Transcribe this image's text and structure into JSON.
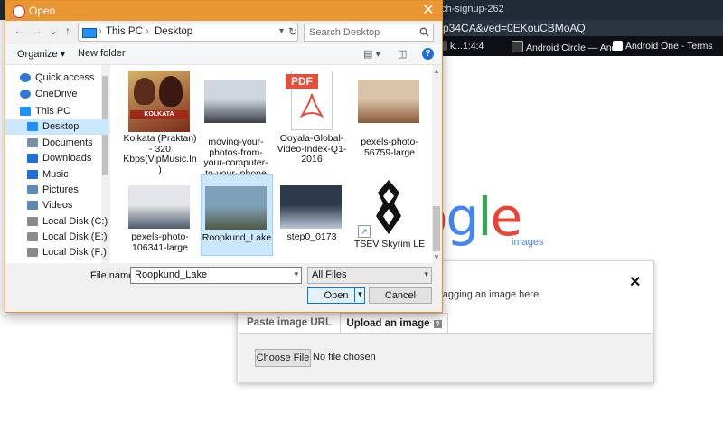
{
  "browser": {
    "tab_text": "ch-signup-262",
    "url_fragment": "p34CA&ved=0EKouCBMoAQ",
    "bookmarks": [
      {
        "label": "k...1:4:4",
        "icon": "bookmark-icon"
      },
      {
        "label": "Android Circle — And",
        "icon": "android-circle-icon"
      },
      {
        "label": "Android One - Terms",
        "icon": "android-one-icon"
      }
    ],
    "colors": {
      "topbar": "#1f2a36",
      "bookmarks_bg": "#0c0f14"
    }
  },
  "google": {
    "logo_letters": [
      "o",
      "g",
      "l",
      "e"
    ],
    "logo_colors": [
      "#ea4335",
      "#4285f4",
      "#34a853",
      "#ea4335"
    ],
    "images_label": "images"
  },
  "search_panel": {
    "hint": "dragging an image here.",
    "close": "✕",
    "tabs": [
      {
        "label": "Paste image URL",
        "active": false
      },
      {
        "label": "Upload an image",
        "active": true
      }
    ],
    "help": "?",
    "choose_file": "Choose File",
    "no_file": "No file chosen"
  },
  "dialog": {
    "title": "Open",
    "close": "✕",
    "nav": {
      "back": "←",
      "forward": "→",
      "recent": "⌄",
      "up": "↑"
    },
    "path": [
      "This PC",
      "Desktop"
    ],
    "path_sep": "›",
    "search_placeholder": "Search Desktop",
    "toolbar": {
      "organize": "Organize ▾",
      "new_folder": "New folder",
      "help": "?"
    },
    "sidebar": [
      {
        "label": "Quick access",
        "icon": "star-icon",
        "color": "#2b7bd6",
        "indent": 0,
        "selected": false
      },
      {
        "label": "OneDrive",
        "icon": "cloud-icon",
        "color": "#2b7bd6",
        "indent": 0,
        "selected": false
      },
      {
        "label": "This PC",
        "icon": "computer-icon",
        "color": "#1e90ff",
        "indent": 0,
        "selected": false
      },
      {
        "label": "Desktop",
        "icon": "desktop-icon",
        "color": "#1e90ff",
        "indent": 1,
        "selected": true
      },
      {
        "label": "Documents",
        "icon": "documents-icon",
        "color": "#7a8fa6",
        "indent": 1,
        "selected": false
      },
      {
        "label": "Downloads",
        "icon": "download-icon",
        "color": "#1e6fd9",
        "indent": 1,
        "selected": false
      },
      {
        "label": "Music",
        "icon": "music-icon",
        "color": "#1e6fd9",
        "indent": 1,
        "selected": false
      },
      {
        "label": "Pictures",
        "icon": "pictures-icon",
        "color": "#5b88b5",
        "indent": 1,
        "selected": false
      },
      {
        "label": "Videos",
        "icon": "videos-icon",
        "color": "#5b88b5",
        "indent": 1,
        "selected": false
      },
      {
        "label": "Local Disk (C:)",
        "icon": "disk-icon",
        "color": "#8a8a8a",
        "indent": 1,
        "selected": false
      },
      {
        "label": "Local Disk (E:)",
        "icon": "disk-icon",
        "color": "#8a8a8a",
        "indent": 1,
        "selected": false
      },
      {
        "label": "Local Disk (F:)",
        "icon": "disk-icon",
        "color": "#8a8a8a",
        "indent": 1,
        "selected": false
      }
    ],
    "files": [
      {
        "name": "Kolkata (Praktan) - 320 Kbps(VipMusic.In)",
        "kind": "album",
        "thumb_colors": [
          "#d8b06a",
          "#7a2d1a"
        ],
        "thumb_label": "KOLKATA",
        "selected": false
      },
      {
        "name": "moving-your-photos-from-your-computer-to-your-iphone",
        "kind": "photo",
        "thumb_colors": [
          "#cfd6e0",
          "#3a3f4a"
        ],
        "thumb_label": "",
        "selected": false
      },
      {
        "name": "Ooyala-Global-Video-Index-Q1-2016",
        "kind": "pdf",
        "thumb_colors": [
          "#e74c3c",
          "#ffffff"
        ],
        "thumb_label": "PDF",
        "selected": false
      },
      {
        "name": "pexels-photo-56759-large",
        "kind": "photo",
        "thumb_colors": [
          "#d9c4a8",
          "#8a5a3c"
        ],
        "thumb_label": "",
        "selected": false
      },
      {
        "name": "pexels-photo-106341-large",
        "kind": "photo",
        "thumb_colors": [
          "#e3e5e8",
          "#4d5b6c"
        ],
        "thumb_label": "",
        "selected": false
      },
      {
        "name": "Roopkund_Lake",
        "kind": "photo",
        "thumb_colors": [
          "#7fa1b8",
          "#4f5a45"
        ],
        "thumb_label": "",
        "selected": true
      },
      {
        "name": "step0_0173",
        "kind": "photo",
        "thumb_colors": [
          "#2c3a4c",
          "#b8c6d8"
        ],
        "thumb_label": "",
        "selected": false
      },
      {
        "name": "TSEV Skyrim LE",
        "kind": "shortcut",
        "thumb_colors": [
          "#111111",
          "#ffffff"
        ],
        "thumb_label": "",
        "selected": false
      }
    ],
    "filename_label": "File name:",
    "filename_value": "Roopkund_Lake",
    "filetype_value": "All Files",
    "open_label": "Open",
    "cancel_label": "Cancel"
  }
}
